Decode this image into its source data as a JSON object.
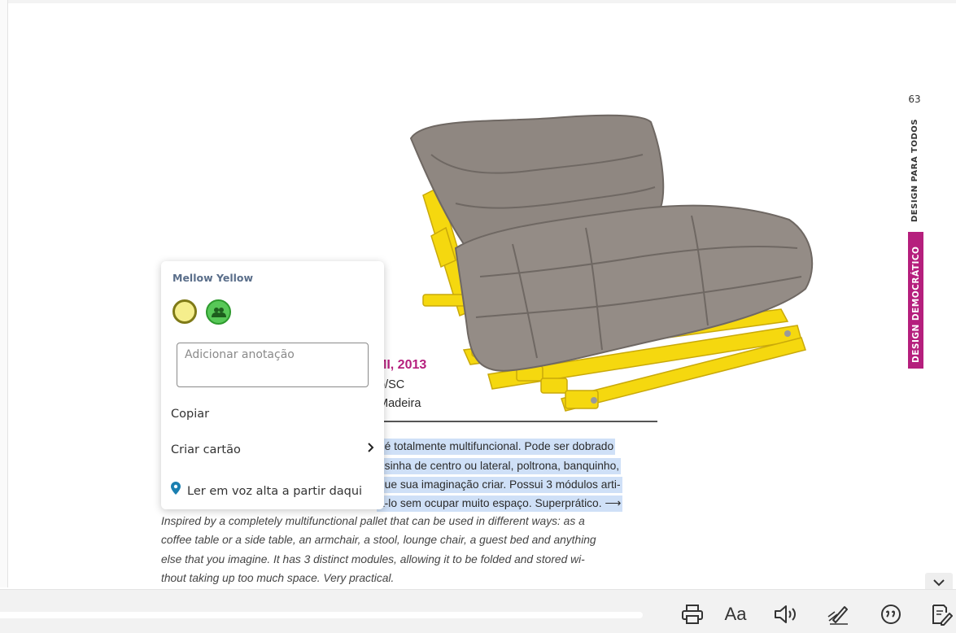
{
  "page": {
    "number": "63",
    "side_section": "DESIGN PARA TODOS",
    "side_chapter": "DESIGN DEMOCRÁTICO"
  },
  "article": {
    "title_fragment": "MI, 2013",
    "meta_lines": [
      "o/SC",
      "Madeira"
    ],
    "pt_lines": [
      ", é totalmente multifuncional. Pode ser dobrado",
      "esinha de centro ou lateral, poltrona, banquinho,",
      "que sua imaginação criar. Possui 3 módulos arti-",
      "á-lo sem ocupar muito espaço. Superprático.  ⟶"
    ],
    "en_lines": [
      "Inspired by a completely multifunctional pallet that can be used in different ways: as a",
      "coffee table or a side table, an armchair, a stool,  lounge chair, a guest bed and anything",
      "else that you imagine. It has 3 distinct modules, allowing it to be folded and stored wi-",
      "thout taking up too much space. Very practical."
    ]
  },
  "popup": {
    "title": "Mellow Yellow",
    "note_placeholder": "Adicionar anotação",
    "copy_label": "Copiar",
    "create_card_label": "Criar cartão",
    "read_aloud_label": "Ler em voz alta a partir daqui",
    "colors": {
      "highlight": "#f5ee8c",
      "highlight_border": "#7f7a17",
      "share": "#57c857"
    }
  },
  "toolbar": {
    "text_size_label": "Aa",
    "icons": [
      "print-icon",
      "text-size-icon",
      "read-aloud-icon",
      "draw-icon",
      "feedback-icon",
      "notes-icon"
    ]
  },
  "colors": {
    "accent": "#b51f7d",
    "selection": "#cfe0f7"
  }
}
